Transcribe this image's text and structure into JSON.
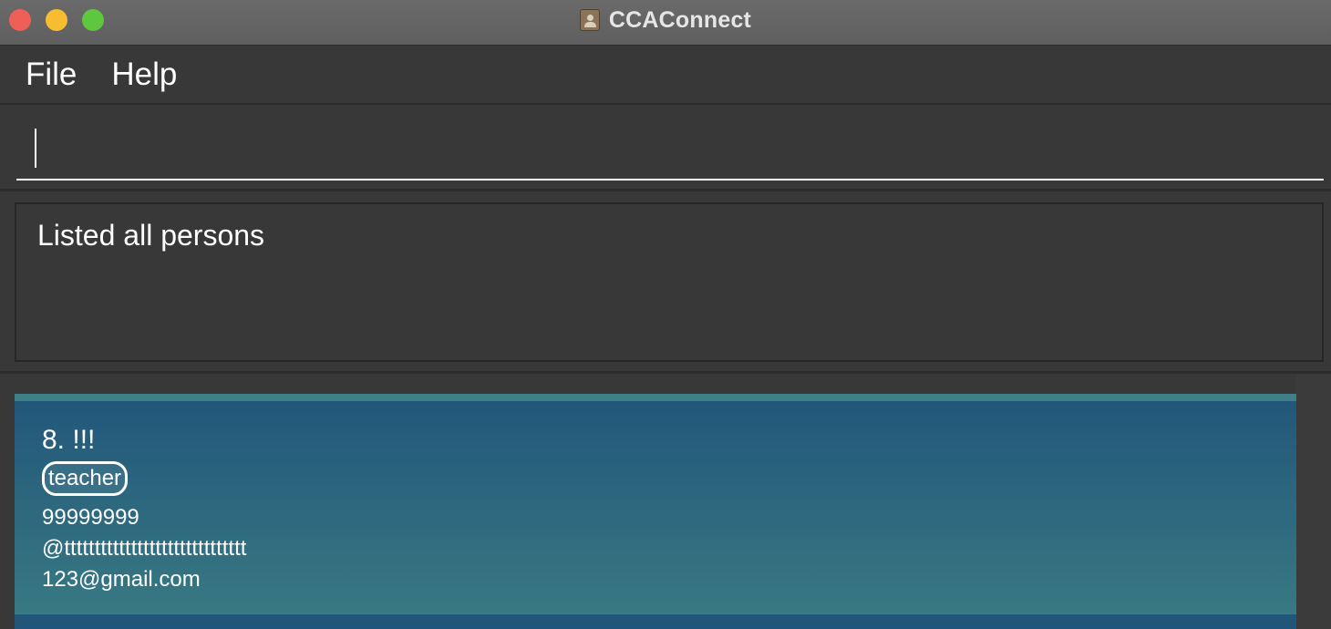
{
  "window": {
    "title": "CCAConnect"
  },
  "menu": {
    "items": [
      "File",
      "Help"
    ]
  },
  "command": {
    "value": "",
    "placeholder": ""
  },
  "result": {
    "message": "Listed all persons"
  },
  "persons": [
    {
      "index_name": "8. !!!",
      "tags": [
        "teacher"
      ],
      "phone": "99999999",
      "telegram": "@tttttttttttttttttttttttttttttt",
      "email": "123@gmail.com"
    }
  ],
  "colors": {
    "background": "#383838",
    "card_top": "#22577a",
    "card_bottom": "#387983",
    "close": "#ee5f57",
    "minimize": "#f5bd2f",
    "zoom": "#5fc63f"
  },
  "icons": {
    "app": "contacts-book-icon"
  }
}
